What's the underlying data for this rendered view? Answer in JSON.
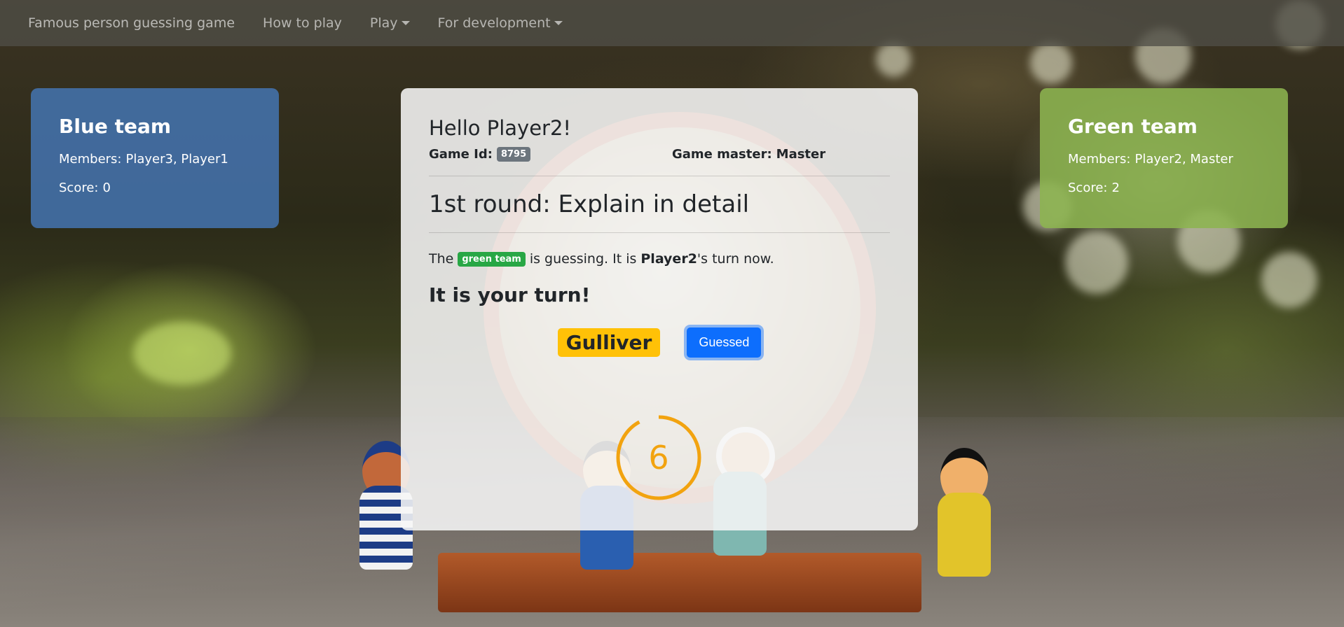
{
  "navbar": {
    "brand": "Famous person guessing game",
    "how_to_play": "How to play",
    "play": "Play",
    "for_development": "For development"
  },
  "blue_team": {
    "title": "Blue team",
    "members_label": "Members:",
    "members": "Player3, Player1",
    "score_label": "Score:",
    "score": "0"
  },
  "green_team": {
    "title": "Green team",
    "members_label": "Members:",
    "members": "Player2, Master",
    "score_label": "Score:",
    "score": "2"
  },
  "game": {
    "greeting": "Hello Player2!",
    "game_id_label": "Game Id:",
    "game_id": "8795",
    "game_master_label": "Game master:",
    "game_master": "Master",
    "round_title": "1st round: Explain in detail",
    "status_prefix": "The",
    "guessing_team": "green team",
    "status_middle": "is guessing. It is",
    "current_player": "Player2",
    "status_suffix": "'s turn now.",
    "your_turn": "It is your turn!",
    "word": "Gulliver",
    "guessed_button": "Guessed",
    "timer": "6",
    "timer_progress": 0.92
  },
  "colors": {
    "blue_team": "#4474b2",
    "green_team": "#8cb450",
    "word_badge": "#ffc107",
    "primary_button": "#0d6efd",
    "green_badge": "#28a745",
    "timer": "#f2a30f"
  }
}
